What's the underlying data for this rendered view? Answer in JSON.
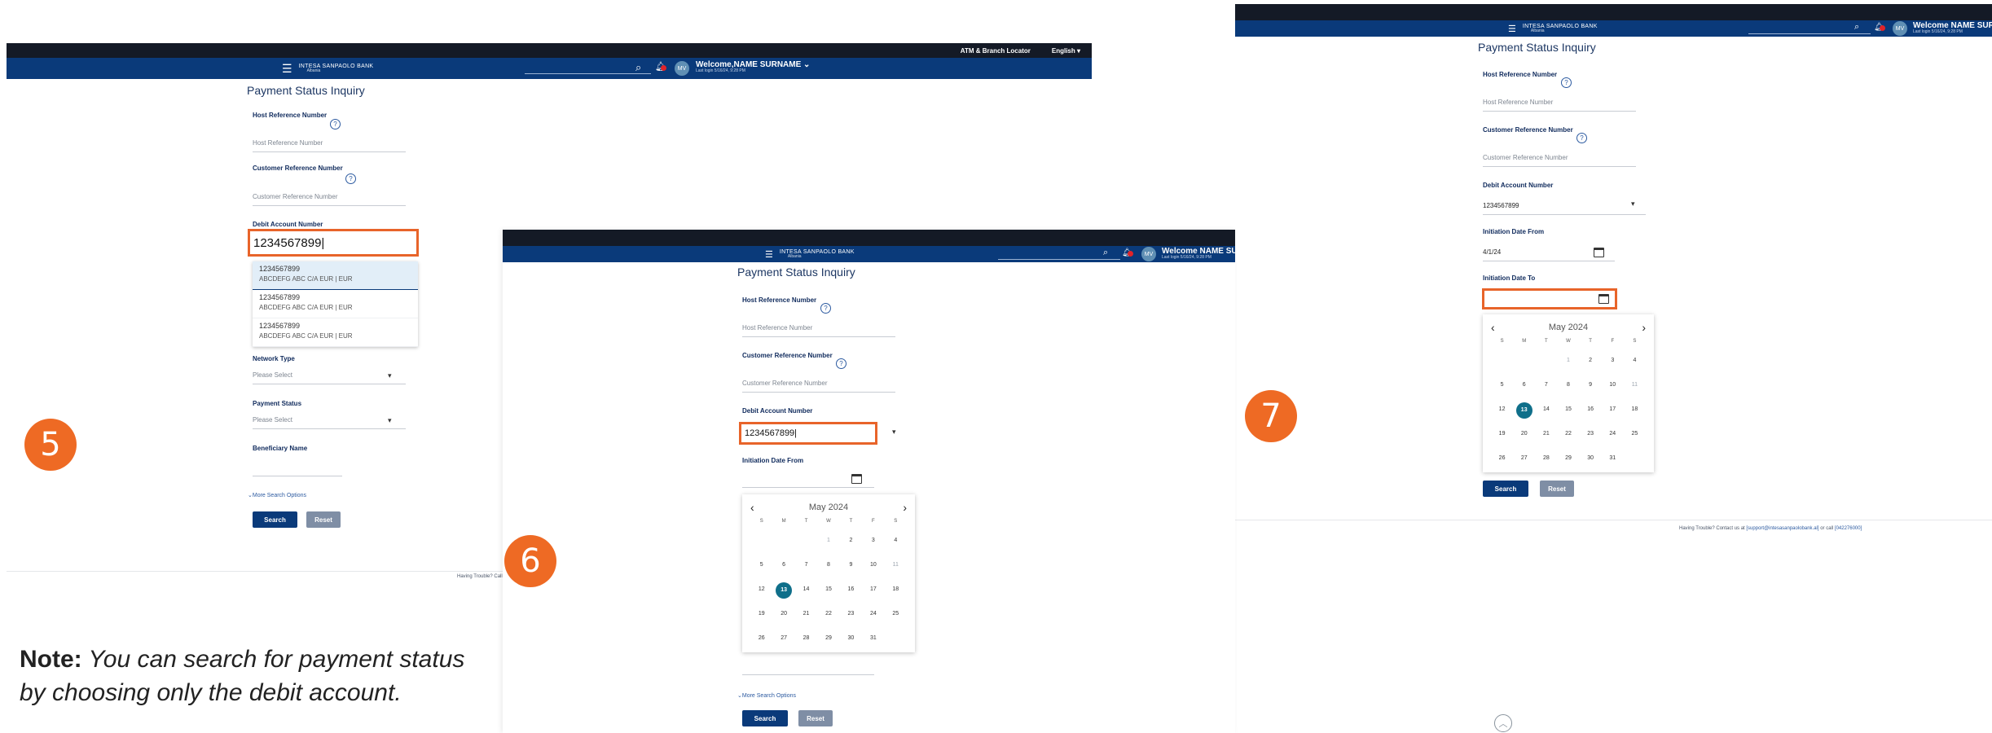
{
  "header": {
    "atm_link": "ATM & Branch Locator",
    "language": "English",
    "bank_name": "INTESA SANPAOLO BANK",
    "bank_country": "Albania",
    "avatar_initials": "MV",
    "welcome_1": "Welcome,NAME SURNAME",
    "welcome_2": "Welcome  NAME SURNAME",
    "welcome_3": "Welcome  NAME SUR",
    "last_login": "Last login 5/16/24, 9:28 PM"
  },
  "page_title": "Payment Status Inquiry",
  "fields": {
    "host_ref_label": "Host Reference Number",
    "host_ref_placeholder": "Host Reference Number",
    "cust_ref_label": "Customer Reference Number",
    "cust_ref_placeholder": "Customer Reference Number",
    "debit_label": "Debit Account Number",
    "debit_value": "1234567899|",
    "debit_value_plain": "1234567899",
    "network_label": "Network Type",
    "network_placeholder": "Please Select",
    "status_label": "Payment Status",
    "status_placeholder": "Please Select",
    "beneficiary_label": "Beneficiary Name",
    "date_from_label": "Initiation Date From",
    "date_from_value": "4/1/24",
    "date_to_label": "Initiation Date To"
  },
  "account_options": [
    {
      "number": "1234567899",
      "desc": "ABCDEFG ABC C/A EUR | EUR"
    },
    {
      "number": "1234567899",
      "desc": "ABCDEFG ABC C/A EUR | EUR"
    },
    {
      "number": "1234567899",
      "desc": "ABCDEFG ABC C/A EUR | EUR"
    }
  ],
  "calendar": {
    "month": "May 2024",
    "dow": [
      "S",
      "M",
      "T",
      "W",
      "T",
      "F",
      "S"
    ],
    "weeks": [
      [
        "",
        "",
        "",
        "1",
        "2",
        "3",
        "4"
      ],
      [
        "5",
        "6",
        "7",
        "8",
        "9",
        "10",
        "11"
      ],
      [
        "12",
        "13",
        "14",
        "15",
        "16",
        "17",
        "18"
      ],
      [
        "19",
        "20",
        "21",
        "22",
        "23",
        "24",
        "25"
      ],
      [
        "26",
        "27",
        "28",
        "29",
        "30",
        "31",
        ""
      ]
    ],
    "today": "13"
  },
  "more_options": "More Search Options",
  "search_label": "Search",
  "reset_label": "Reset",
  "footer_short": "Having Trouble? Call",
  "footer_prefix": "Having Trouble? Contact us at",
  "footer_email": "[support@intesasanpaolobank.al]",
  "footer_mid": "or call",
  "footer_phone": "[042276000]",
  "steps": [
    "5",
    "6",
    "7"
  ],
  "note_bold": "Note:",
  "note_text": " You can search for payment status by choosing only the debit account."
}
